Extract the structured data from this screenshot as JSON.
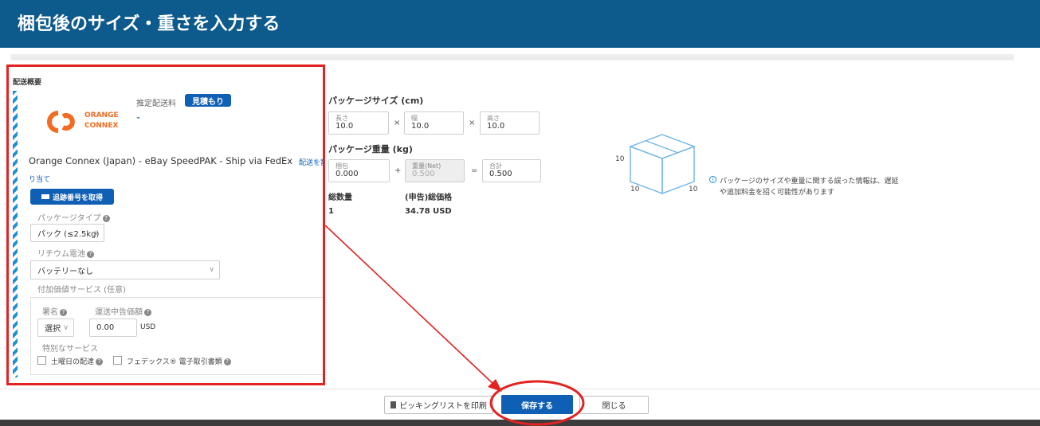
{
  "header": {
    "title": "梱包後のサイズ・重さを入力する"
  },
  "summary": {
    "heading": "配送概要",
    "estimate_label": "推定配送料",
    "estimate_button": "見積もり",
    "estimate_value": "-",
    "logo": {
      "line1": "ORANGE",
      "line2": "CONNEX",
      "icon": "orange-connex-logo"
    },
    "service_name": "Orange Connex (Japan) - eBay SpeedPAK - Ship via FedEx",
    "assign_link_1": "配送を割",
    "assign_link_2": "り当て",
    "tracking_button": "追跡番号を取得",
    "package_type_label": "パッケージタイプ",
    "package_type_value": "パック (≤2.5kg)",
    "lithium_label": "リチウム電池",
    "lithium_value": "バッテリーなし",
    "extra_services_label": "付加価値サービス (任意)",
    "signature_label": "署名",
    "signature_value": "選択",
    "declared_label": "運送中告価額",
    "declared_value": "0.00",
    "declared_unit": "USD",
    "special_label": "特別なサービス",
    "saturday_label": "土曜日の配達",
    "fedex_label": "フェデックス® 電子取引書類"
  },
  "package": {
    "size_title": "パッケージサイズ (cm)",
    "length_cap": "長さ",
    "length_val": "10.0",
    "width_cap": "幅",
    "width_val": "10.0",
    "height_cap": "高さ",
    "height_val": "10.0",
    "times": "×",
    "weight_title": "パッケージ重量 (kg)",
    "pack_cap": "梱包",
    "pack_val": "0.000",
    "net_cap": "重量(Net)",
    "net_val": "0.500",
    "total_cap": "合計",
    "total_val": "0.500",
    "plus": "+",
    "equals": "=",
    "qty_label": "総数量",
    "qty_value": "1",
    "price_label": "(申告)総価格",
    "price_value": "34.78 USD"
  },
  "diagram": {
    "dim_top": "10",
    "dim_left": "10",
    "dim_right": "10",
    "notice": "パッケージのサイズや重量に関する誤った情報は、遅延",
    "notice2": "や追加料金を招く可能性があります"
  },
  "footer": {
    "print_label": "ピッキングリストを印刷",
    "save_label": "保存する",
    "close_label": "閉じる"
  },
  "colors": {
    "header": "#0d5a8c",
    "accent": "#0f5fb5",
    "annotation": "#e32222",
    "logo": "#f26b21"
  }
}
